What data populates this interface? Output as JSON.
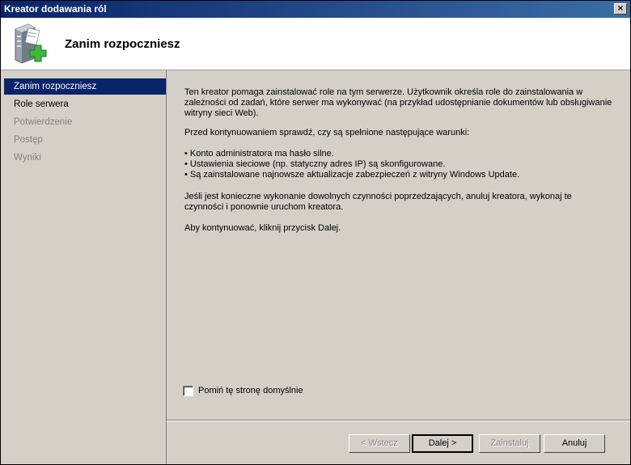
{
  "window": {
    "title": "Kreator dodawania ról",
    "close_label": "×"
  },
  "header": {
    "title": "Zanim rozpoczniesz",
    "icon": "server-add-icon"
  },
  "sidebar": {
    "items": [
      {
        "label": "Zanim rozpoczniesz",
        "state": "active"
      },
      {
        "label": "Role serwera",
        "state": "normal"
      },
      {
        "label": "Potwierdzenie",
        "state": "disabled"
      },
      {
        "label": "Postęp",
        "state": "disabled"
      },
      {
        "label": "Wyniki",
        "state": "disabled"
      }
    ]
  },
  "content": {
    "intro": "Ten kreator pomaga zainstalować role na tym serwerze. Użytkownik określa role do zainstalowania w zależności od zadań, które serwer ma wykonywać (na przykład udostępnianie dokumentów lub obsługiwanie witryny sieci Web).",
    "check_heading": "Przed kontynuowaniem sprawdź, czy są spełnione następujące warunki:",
    "bullets": [
      "Konto administratora ma hasło silne.",
      "Ustawienia sieciowe (np. statyczny adres IP) są skonfigurowane.",
      "Są zainstalowane najnowsze aktualizacje zabezpieczeń z witryny Windows Update."
    ],
    "cancel_note": "Jeśli jest konieczne wykonanie dowolnych czynności poprzedzających, anuluj kreatora, wykonaj te czynności i ponownie uruchom kreatora.",
    "continue_note": "Aby kontynuować, kliknij przycisk Dalej."
  },
  "skip_checkbox": {
    "label": "Pomiń tę stronę domyślnie",
    "checked": false
  },
  "buttons": {
    "back": "< Wstecz",
    "next": "Dalej >",
    "install": "Zainstaluj",
    "cancel": "Anuluj"
  },
  "colors": {
    "title_bar": "#0a246a",
    "selection": "#0a246a",
    "face": "#d4d0c8"
  }
}
